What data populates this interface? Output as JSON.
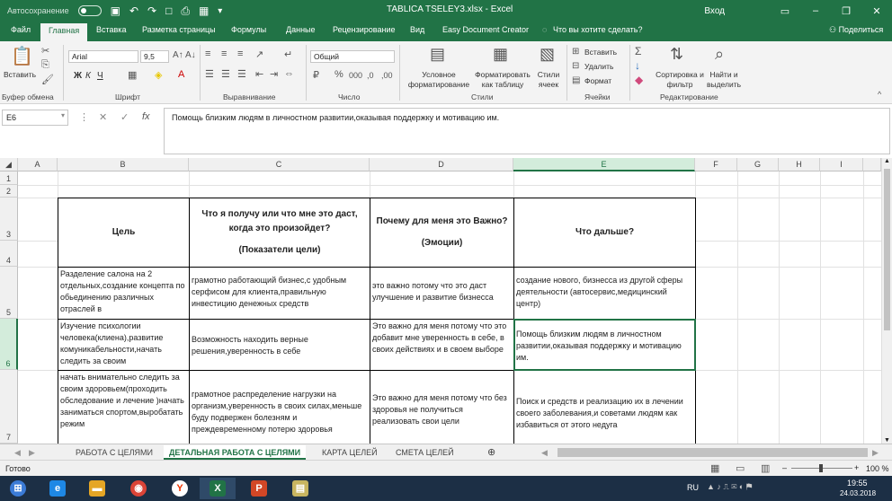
{
  "titlebar": {
    "autosave_label": "Автосохранение",
    "autosave_state": "Откл.",
    "doc_title": "TABLICA TSELEY3.xlsx  -  Excel",
    "signin": "Вход"
  },
  "tabs": [
    "Файл",
    "Главная",
    "Вставка",
    "Разметка страницы",
    "Формулы",
    "Данные",
    "Рецензирование",
    "Вид",
    "Easy Document Creator"
  ],
  "tell_me": "Что вы хотите сделать?",
  "share": "Поделиться",
  "ribbon": {
    "paste": "Вставить",
    "clipboard": "Буфер обмена",
    "font_name": "Arial",
    "font_size": "9,5",
    "bold": "Ж",
    "italic": "К",
    "underline": "Ч",
    "font_group": "Шрифт",
    "align_group": "Выравнивание",
    "number_format": "Общий",
    "number_group": "Число",
    "cond_format": "Условное форматирование",
    "format_table": "Форматировать как таблицу",
    "cell_styles": "Стили ячеек",
    "styles_group": "Стили",
    "insert": "Вставить",
    "delete": "Удалить",
    "format": "Формат",
    "cells_group": "Ячейки",
    "sort": "Сортировка и фильтр",
    "find": "Найти и выделить",
    "edit_group": "Редактирование"
  },
  "formula": {
    "name_box": "E6",
    "fx": "fx",
    "content": "Помощь близким  людям в личностном развитии,оказывая поддержку и мотивацию им."
  },
  "columns": [
    "A",
    "B",
    "C",
    "D",
    "E",
    "F",
    "G",
    "H",
    "I"
  ],
  "rows": [
    "1",
    "2",
    "3",
    "4",
    "5",
    "6",
    "7"
  ],
  "table": {
    "h_b": "Цель",
    "h_c1": "Что я получу или что мне это даст, когда это произойдет?",
    "h_c2": "(Показатели цели)",
    "h_d1": "Почему для меня это Важно?",
    "h_d2": "(Эмоции)",
    "h_e": "Что дальше?",
    "r5_b": "Разделение салона на 2 отдельных,создание концепта по обьединению различных отраслей в",
    "r5_c": " грамотно работающий бизнес,с удобным серфисом для клиента,правильную инвестицию денежных средств",
    "r5_d": "это важно потому что это даст улучшение и развитие  бизнесса",
    "r5_e": "создание нового,  бизнесса  из другой сферы деятельности (автосервис,медицинский центр)",
    "r6_b": "Изучение психологии человека(клиена),развитие комуникабельности,начать следить за своим",
    "r6_c": "Возможность находить верные решения,уверенность в себе",
    "r6_d": "Это важно для меня потому что это добавит мне уверенность в себе, в своих действиях и в своем выборе",
    "r6_e": "Помощь близким  людям в личностном развитии,оказывая поддержку и мотивацию им.",
    "r7_b": "начать внимательно следить за своим здоровьем(проходить обследование и лечение )начать заниматься спортом,выробатать режим",
    "r7_c": "грамотное распределение нагрузки на организм,уверенность в своих силах,меньше буду подвержен болезням и преждевременному потерю здоровья",
    "r7_d": "Это важно для меня потому что без здоровья не получиться реализовать свои цели",
    "r7_e": "Поиск и средств и реализацию их в лечении своего  заболевания,и советами людям как избавиться от этого недуга"
  },
  "sheets": [
    "РАБОТА С ЦЕЛЯМИ",
    "ДЕТАЛЬНАЯ РАБОТА С ЦЕЛЯМИ",
    "КАРТА ЦЕЛЕЙ",
    "СМЕТА ЦЕЛЕЙ"
  ],
  "status": {
    "ready": "Готово",
    "zoom": "100 %"
  },
  "taskbar": {
    "lang": "RU",
    "time": "19:55",
    "date": "24.03.2018"
  },
  "colors": {
    "accent": "#217346",
    "taskbar": "#1c2f45"
  }
}
